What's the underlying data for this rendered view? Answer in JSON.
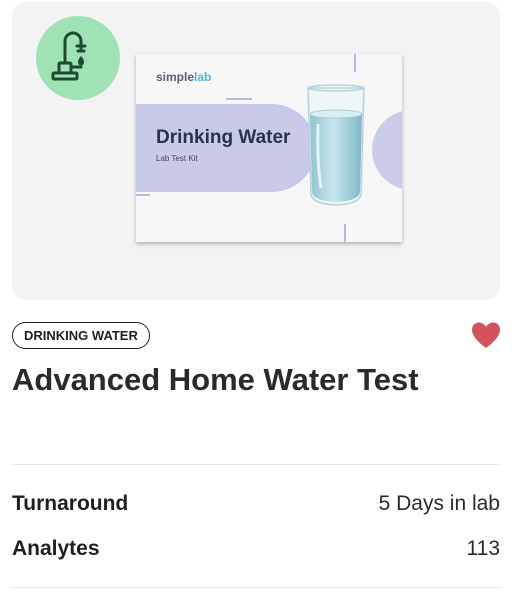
{
  "category": {
    "label": "DRINKING WATER",
    "icon": "faucet-icon"
  },
  "favorite": {
    "icon": "heart-icon",
    "active": true,
    "color": "#d2535d"
  },
  "product": {
    "name": "Advanced Home Water Test",
    "box": {
      "brand_prefix": "simple",
      "brand_suffix": "lab",
      "title": "Drinking Water",
      "subtitle": "Lab Test Kit"
    }
  },
  "specs": [
    {
      "label": "Turnaround",
      "value": "5 Days in lab"
    },
    {
      "label": "Analytes",
      "value": "113"
    }
  ],
  "colors": {
    "icon_badge": "#9fe2b4",
    "icon_stroke": "#1e4a33",
    "box_accent": "#c9cae9",
    "brand_lab": "#5ab1e0"
  }
}
